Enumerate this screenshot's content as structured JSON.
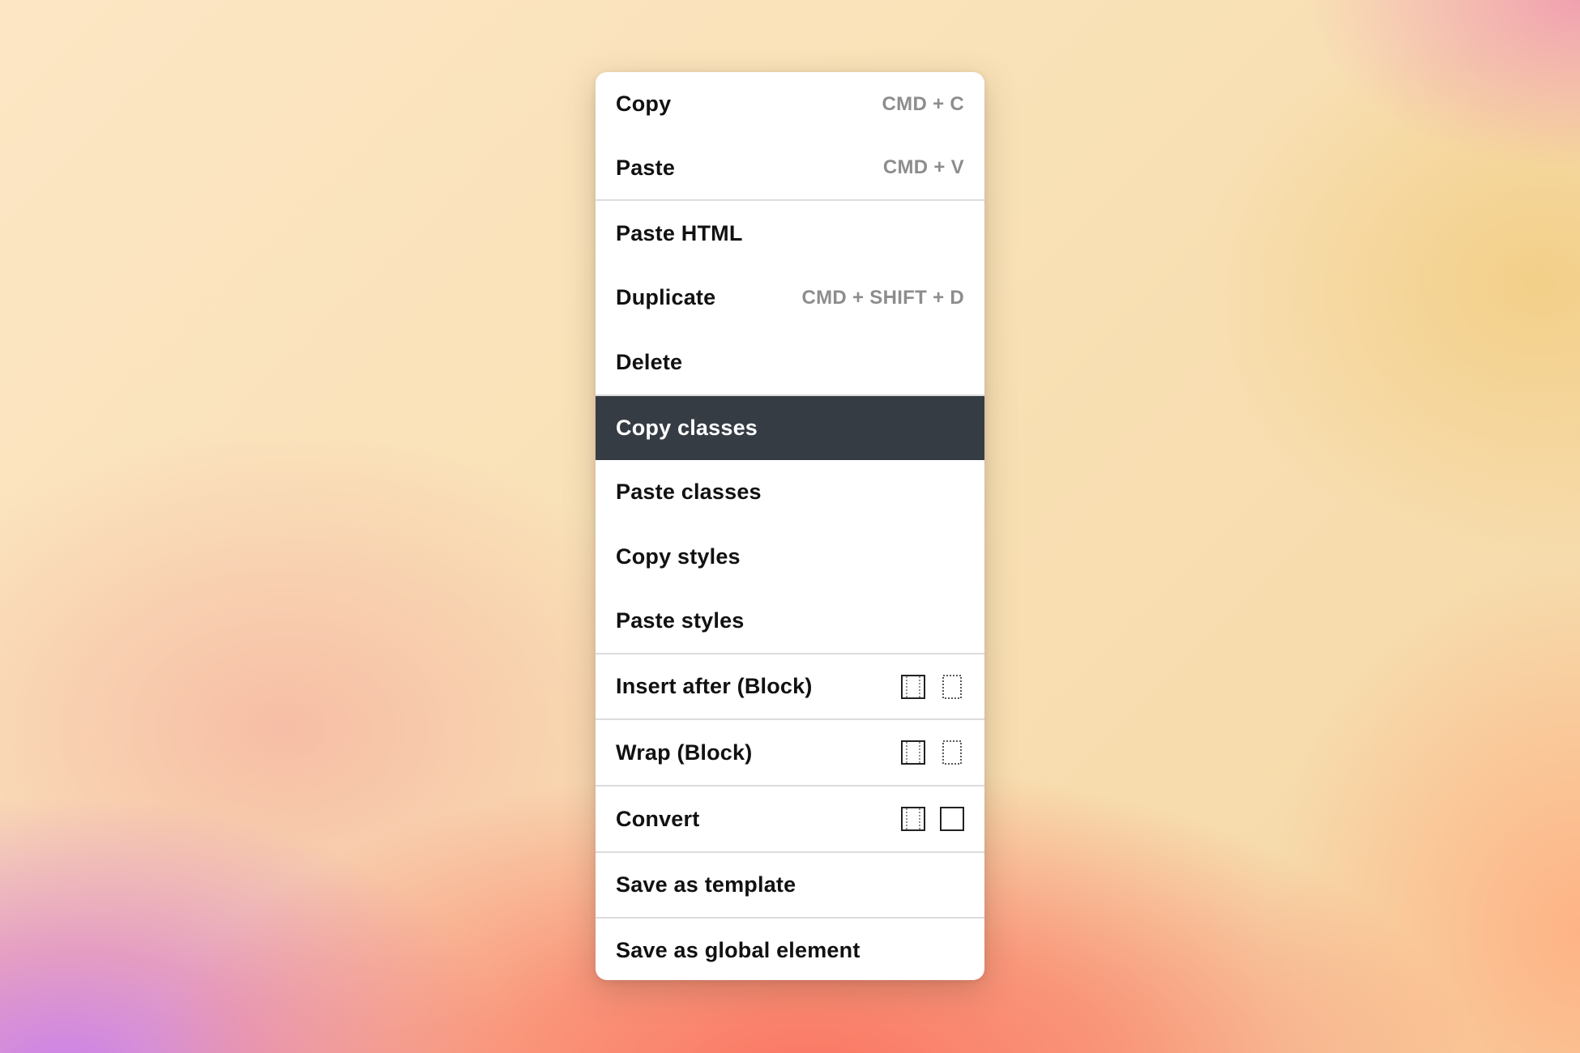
{
  "menu": {
    "items": [
      {
        "label": "Copy",
        "shortcut": "CMD + C"
      },
      {
        "label": "Paste",
        "shortcut": "CMD + V"
      },
      {
        "label": "Paste HTML",
        "shortcut": ""
      },
      {
        "label": "Duplicate",
        "shortcut": "CMD + SHIFT + D"
      },
      {
        "label": "Delete",
        "shortcut": ""
      },
      {
        "label": "Copy classes",
        "shortcut": "",
        "active": true
      },
      {
        "label": "Paste classes",
        "shortcut": ""
      },
      {
        "label": "Copy styles",
        "shortcut": ""
      },
      {
        "label": "Paste styles",
        "shortcut": ""
      },
      {
        "label": "Insert after (Block)",
        "icons": [
          "block-bordered-icon",
          "block-dotted-icon"
        ]
      },
      {
        "label": "Wrap (Block)",
        "icons": [
          "block-bordered-icon",
          "block-dotted-icon"
        ]
      },
      {
        "label": "Convert",
        "icons": [
          "block-bordered-icon",
          "block-solid-icon"
        ]
      },
      {
        "label": "Save as template"
      },
      {
        "label": "Save as global element"
      }
    ]
  },
  "colors": {
    "active_bg": "#363c44",
    "shortcut_text": "#8d8d8d",
    "divider": "#dcdcdc"
  }
}
